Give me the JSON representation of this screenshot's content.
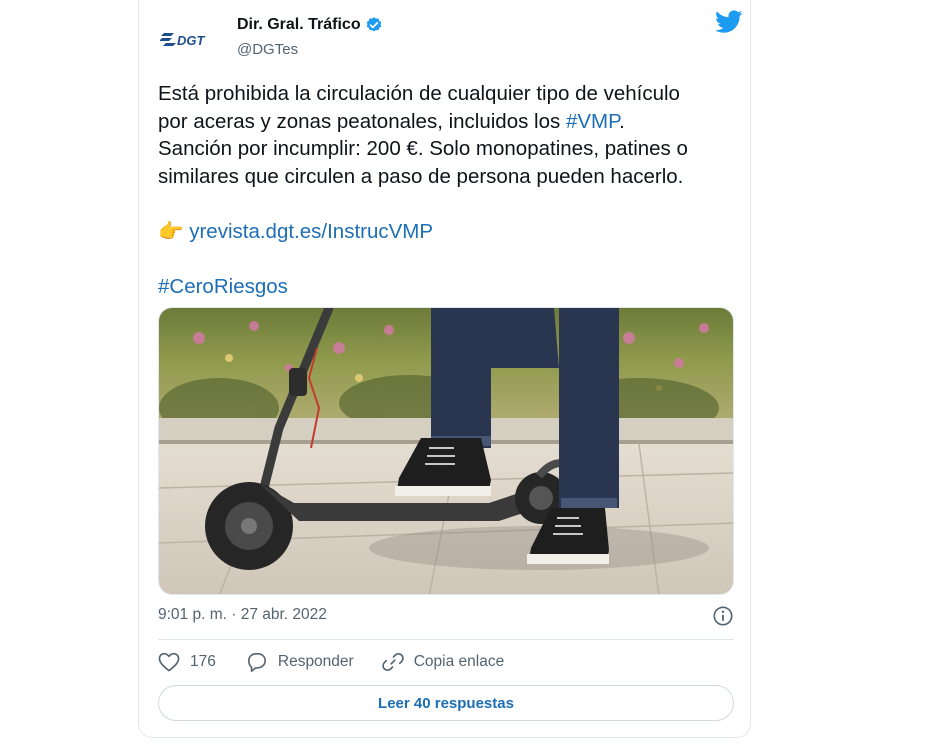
{
  "tweet": {
    "author": {
      "display_name": "Dir. Gral. Tráfico",
      "handle": "@DGTes",
      "avatar_text": "DGT",
      "verified": true
    },
    "text": {
      "line1": "Está prohibida la circulación de cualquier tipo de vehículo",
      "line2_prefix": "por aceras y zonas peatonales, incluidos los ",
      "line2_hashtag": "#VMP",
      "line2_suffix": ".",
      "line3": "Sanción por incumplir: 200 €. Solo monopatines, patines o",
      "line4": "similares que circulen a paso de persona pueden hacerlo.",
      "pointer_emoji": "👉",
      "link": "yrevista.dgt.es/InstrucVMP",
      "hashtag": "#CeroRiesgos"
    },
    "timestamp": "9:01 p. m. · 27 abr. 2022",
    "likes": "176",
    "reply_label": "Responder",
    "copy_link_label": "Copia enlace",
    "read_replies_label": "Leer 40 respuestas"
  },
  "colors": {
    "accent": "#1d9bf0",
    "link": "#1d6fb5",
    "secondary_text": "#536471",
    "border": "#e1e8ed"
  },
  "icons": [
    "dgt-logo-icon",
    "verified-badge-icon",
    "twitter-bird-icon",
    "info-icon",
    "heart-icon",
    "reply-icon",
    "link-icon"
  ]
}
